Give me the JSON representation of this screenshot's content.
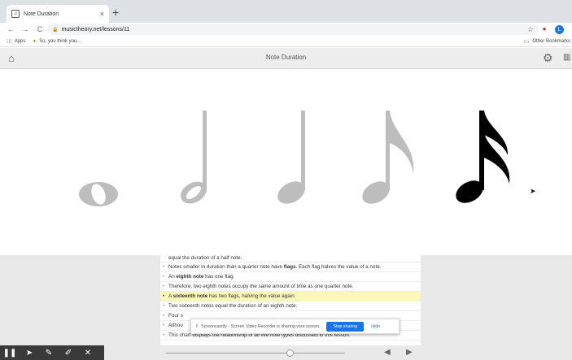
{
  "browser": {
    "tab_title": "Note Duration",
    "tab_close": "×",
    "new_tab": "+",
    "url": "musictheory.net/lessons/11",
    "nav": {
      "back": "←",
      "forward": "→",
      "reload": "C"
    },
    "bookmarks": [
      {
        "label": "Apps",
        "icon": "apps-grid-icon"
      },
      {
        "label": "So, you think you...",
        "icon": "bookmark-favicon"
      }
    ],
    "other_bookmarks": "Other Bookmarks",
    "profile_initial": "L"
  },
  "app": {
    "title": "Note Duration",
    "icons": [
      "home-icon",
      "gear-icon",
      "library-icon"
    ]
  },
  "notes": [
    {
      "name": "whole-note",
      "color": "#bdbdbd"
    },
    {
      "name": "half-note",
      "color": "#bdbdbd"
    },
    {
      "name": "quarter-note",
      "color": "#bdbdbd"
    },
    {
      "name": "eighth-note",
      "color": "#bdbdbd"
    },
    {
      "name": "sixteenth-note",
      "color": "#000000"
    }
  ],
  "lesson": {
    "top_partial": "equal the duration of a half note.",
    "lines": [
      {
        "parts": [
          {
            "t": "Notes smaller in duration than a quarter note have ",
            "b": false
          },
          {
            "t": "flags",
            "b": true
          },
          {
            "t": ". Each flag halves the value of a note.",
            "b": false
          }
        ],
        "highlight": false
      },
      {
        "parts": [
          {
            "t": "An ",
            "b": false
          },
          {
            "t": "eighth note",
            "b": true
          },
          {
            "t": " has one flag.",
            "b": false
          }
        ],
        "highlight": false
      },
      {
        "parts": [
          {
            "t": "Therefore, two eighth notes occupy the same amount of time as one quarter note.",
            "b": false
          }
        ],
        "highlight": false
      },
      {
        "parts": [
          {
            "t": "A ",
            "b": false
          },
          {
            "t": "sixteenth note",
            "b": true
          },
          {
            "t": " has two flags, halving the value again.",
            "b": false
          }
        ],
        "highlight": true
      },
      {
        "parts": [
          {
            "t": "Two sixteenth notes equal the duration of an eighth note.",
            "b": false
          }
        ],
        "highlight": false
      },
      {
        "parts": [
          {
            "t": "Four s",
            "b": false
          }
        ],
        "highlight": false
      },
      {
        "parts": [
          {
            "t": "Althou",
            "b": false
          }
        ],
        "highlight": false
      },
      {
        "parts": [
          {
            "t": "This chart displays the relationship of all five note types discussed in this lesson.",
            "b": false
          }
        ],
        "highlight": false
      }
    ]
  },
  "screencastify": {
    "message": "Screencastify - Screen Video Recorder is sharing your screen.",
    "stop_label": "Stop sharing",
    "hide_label": "Hide"
  },
  "drawing_tools": [
    "pause-icon",
    "pointer-icon",
    "pen-icon",
    "highlighter-icon",
    "close-icon"
  ],
  "player": {
    "progress": 0.69,
    "prev": "◀",
    "next": "▶"
  },
  "colors": {
    "accent": "#1a73e8",
    "highlight": "#fbf7b9",
    "gray_note": "#bdbdbd",
    "active_note": "#000000"
  }
}
